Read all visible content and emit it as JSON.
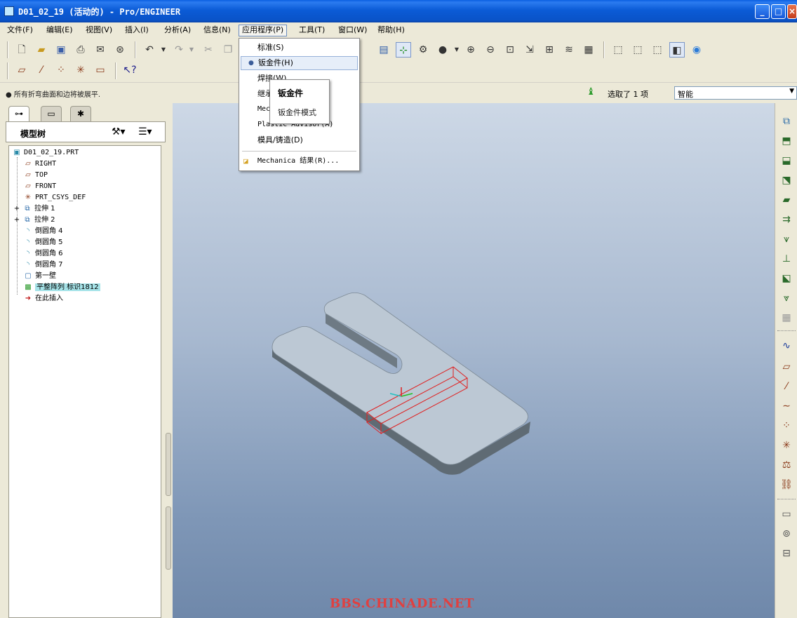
{
  "window": {
    "title": "D01_02_19 (活动的) - Pro/ENGINEER"
  },
  "menubar": {
    "items": [
      "文件(F)",
      "编辑(E)",
      "视图(V)",
      "插入(I)",
      "分析(A)",
      "信息(N)",
      "应用程序(P)",
      "工具(T)",
      "窗口(W)",
      "帮助(H)"
    ],
    "active": "应用程序(P)"
  },
  "status": {
    "message": "● 所有折弯曲面和边将被展平.",
    "selection": "选取了 1 项",
    "filter": "智能"
  },
  "model_tree": {
    "title": "模型树",
    "items": [
      {
        "label": "D01_02_19.PRT",
        "icon": "part-icon"
      },
      {
        "label": "RIGHT",
        "icon": "datum-plane-icon"
      },
      {
        "label": "TOP",
        "icon": "datum-plane-icon"
      },
      {
        "label": "FRONT",
        "icon": "datum-plane-icon"
      },
      {
        "label": "PRT_CSYS_DEF",
        "icon": "csys-icon"
      },
      {
        "label": "拉伸 1",
        "icon": "extrude-icon"
      },
      {
        "label": "拉伸 2",
        "icon": "extrude-icon"
      },
      {
        "label": "倒圆角 4",
        "icon": "round-icon"
      },
      {
        "label": "倒圆角 5",
        "icon": "round-icon"
      },
      {
        "label": "倒圆角 6",
        "icon": "round-icon"
      },
      {
        "label": "倒圆角 7",
        "icon": "round-icon"
      },
      {
        "label": "第一壁",
        "icon": "wall-icon"
      },
      {
        "label": "平整阵列 标识1812",
        "icon": "flat-pattern-icon"
      },
      {
        "label": "在此插入",
        "icon": "insert-here-arrow-icon"
      }
    ]
  },
  "applications_menu": {
    "items": [
      {
        "label": "标准(S)",
        "icon": ""
      },
      {
        "label": "钣金件(H)",
        "icon": "bullet-icon",
        "highlighted": true
      },
      {
        "label": "焊接(W)",
        "icon": ""
      },
      {
        "label": "继承(I)",
        "icon": ""
      },
      {
        "label": "Mechanica",
        "icon": ""
      },
      {
        "label": "Plastic Advisor(A)",
        "icon": ""
      },
      {
        "label": "模具/铸造(D)",
        "icon": ""
      },
      {
        "label": "Mechanica 结果(R)...",
        "icon": "mechanica-results-icon"
      }
    ]
  },
  "submenu": {
    "title": "钣金件",
    "item": "钣金件模式"
  },
  "watermark": "BBS.CHINADE.NET",
  "colors": {
    "titlebar": "#0a5fe0",
    "part_face": "#bcc8d4",
    "part_side": "#6e7a84",
    "selection_box": "#e02020",
    "watermark": "#e04040"
  }
}
